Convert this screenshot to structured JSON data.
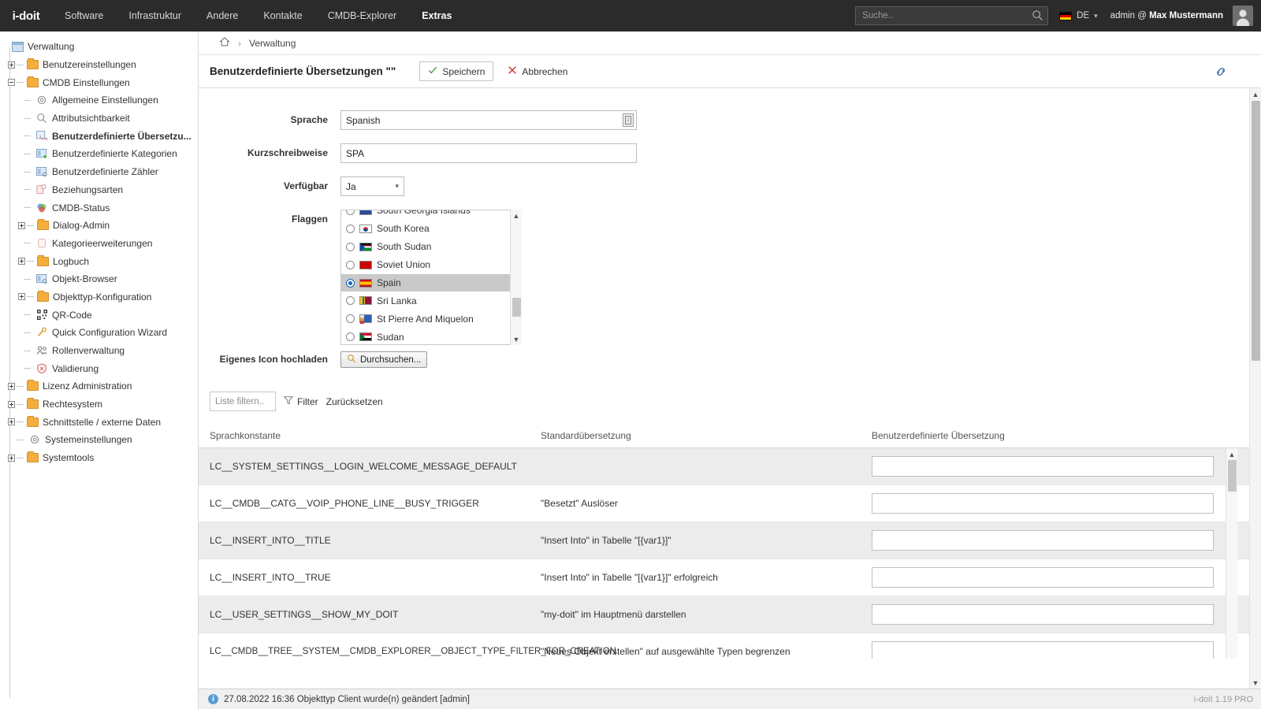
{
  "app": {
    "logo": "i-doit",
    "version_label": "i-doit 1.19 PRO"
  },
  "topnav": {
    "items": [
      {
        "label": "Software",
        "active": false
      },
      {
        "label": "Infrastruktur",
        "active": false
      },
      {
        "label": "Andere",
        "active": false
      },
      {
        "label": "Kontakte",
        "active": false
      },
      {
        "label": "CMDB-Explorer",
        "active": false
      },
      {
        "label": "Extras",
        "active": true
      }
    ],
    "search_placeholder": "Suche..",
    "search_value": "",
    "language": "DE",
    "user": "admin @ ",
    "user_name": "Max Mustermann"
  },
  "sidebar": {
    "root": "Verwaltung",
    "items": [
      {
        "label": "Verwaltung",
        "level": 0,
        "icon": "window-icon",
        "toggle": "none",
        "selected": false
      },
      {
        "label": "Benutzereinstellungen",
        "level": 1,
        "icon": "folder-icon",
        "toggle": "plus",
        "selected": false
      },
      {
        "label": "CMDB Einstellungen",
        "level": 1,
        "icon": "folder-icon",
        "toggle": "minus",
        "selected": false
      },
      {
        "label": "Allgemeine Einstellungen",
        "level": 2,
        "icon": "gear-icon",
        "toggle": "dash",
        "selected": false
      },
      {
        "label": "Attributsichtbarkeit",
        "level": 2,
        "icon": "search-icon",
        "toggle": "dash",
        "selected": false
      },
      {
        "label": "Benutzerdefinierte Übersetzu...",
        "level": 2,
        "icon": "translation-icon",
        "toggle": "dash",
        "selected": true
      },
      {
        "label": "Benutzerdefinierte Kategorien",
        "level": 2,
        "icon": "category-icon",
        "toggle": "dash",
        "selected": false
      },
      {
        "label": "Benutzerdefinierte Zähler",
        "level": 2,
        "icon": "counter-icon",
        "toggle": "dash",
        "selected": false
      },
      {
        "label": "Beziehungsarten",
        "level": 2,
        "icon": "relation-icon",
        "toggle": "dash",
        "selected": false
      },
      {
        "label": "CMDB-Status",
        "level": 2,
        "icon": "status-icon",
        "toggle": "dash",
        "selected": false
      },
      {
        "label": "Dialog-Admin",
        "level": 2,
        "icon": "folder-icon",
        "toggle": "plus",
        "selected": false
      },
      {
        "label": "Kategorieerweiterungen",
        "level": 2,
        "icon": "extension-icon",
        "toggle": "dash",
        "selected": false
      },
      {
        "label": "Logbuch",
        "level": 2,
        "icon": "folder-icon",
        "toggle": "plus",
        "selected": false
      },
      {
        "label": "Objekt-Browser",
        "level": 2,
        "icon": "browser-icon",
        "toggle": "dash",
        "selected": false
      },
      {
        "label": "Objekttyp-Konfiguration",
        "level": 2,
        "icon": "folder-icon",
        "toggle": "plus",
        "selected": false
      },
      {
        "label": "QR-Code",
        "level": 2,
        "icon": "qrcode-icon",
        "toggle": "dash",
        "selected": false
      },
      {
        "label": "Quick Configuration Wizard",
        "level": 2,
        "icon": "wand-icon",
        "toggle": "dash",
        "selected": false
      },
      {
        "label": "Rollenverwaltung",
        "level": 2,
        "icon": "users-icon",
        "toggle": "dash",
        "selected": false
      },
      {
        "label": "Validierung",
        "level": 2,
        "icon": "shield-icon",
        "toggle": "dash",
        "selected": false
      },
      {
        "label": "Lizenz Administration",
        "level": 1,
        "icon": "folder-icon",
        "toggle": "plus",
        "selected": false
      },
      {
        "label": "Rechtesystem",
        "level": 1,
        "icon": "folder-icon",
        "toggle": "plus",
        "selected": false
      },
      {
        "label": "Schnittstelle / externe Daten",
        "level": 1,
        "icon": "folder-icon",
        "toggle": "plus",
        "selected": false
      },
      {
        "label": "Systemeinstellungen",
        "level": 1,
        "icon": "gear-icon",
        "toggle": "dash",
        "selected": false
      },
      {
        "label": "Systemtools",
        "level": 1,
        "icon": "folder-icon",
        "toggle": "plus",
        "selected": false
      }
    ]
  },
  "breadcrumb": {
    "home": "home-icon",
    "separator": "›",
    "current": "Verwaltung"
  },
  "header": {
    "title": "Benutzerdefinierte Übersetzungen \"\"",
    "save_label": "Speichern",
    "cancel_label": "Abbrechen"
  },
  "form": {
    "sprache_label": "Sprache",
    "sprache_value": "Spanish",
    "kurz_label": "Kurzschreibweise",
    "kurz_value": "SPA",
    "verfuegbar_label": "Verfügbar",
    "verfuegbar_value": "Ja",
    "flaggen_label": "Flaggen",
    "flags": [
      {
        "name": "South Georgia Islands",
        "selected": false,
        "c1": "#3a5aa8",
        "c2": "#ffffff",
        "partial": true
      },
      {
        "name": "South Korea",
        "selected": false,
        "c1": "#ffffff",
        "c2": "#cd2e3a"
      },
      {
        "name": "South Sudan",
        "selected": false,
        "c1": "#078930",
        "c2": "#0f47af"
      },
      {
        "name": "Soviet Union",
        "selected": false,
        "c1": "#cd0000",
        "c2": "#ffd700"
      },
      {
        "name": "Spain",
        "selected": true,
        "c1": "#c60b1e",
        "c2": "#ffc400"
      },
      {
        "name": "Sri Lanka",
        "selected": false,
        "c1": "#ffbe29",
        "c2": "#8d153a"
      },
      {
        "name": "St Pierre And Miquelon",
        "selected": false,
        "c1": "#2c5fb3",
        "c2": "#e8e8e8"
      },
      {
        "name": "Sudan",
        "selected": false,
        "c1": "#d21034",
        "c2": "#ffffff"
      }
    ],
    "upload_label": "Eigenes Icon hochladen",
    "upload_button": "Durchsuchen..."
  },
  "filterbar": {
    "placeholder": "Liste filtern..",
    "value": "",
    "filter_label": "Filter",
    "reset_label": "Zurücksetzen"
  },
  "table": {
    "columns": [
      "Sprachkonstante",
      "Standardübersetzung",
      "Benutzerdefinierte Übersetzung"
    ],
    "rows": [
      {
        "constant": "LC__SYSTEM_SETTINGS__LOGIN_WELCOME_MESSAGE_DEFAULT",
        "default": "",
        "custom": ""
      },
      {
        "constant": "LC__CMDB__CATG__VOIP_PHONE_LINE__BUSY_TRIGGER",
        "default": "\"Besetzt\" Auslöser",
        "custom": ""
      },
      {
        "constant": "LC__INSERT_INTO__TITLE",
        "default": "\"Insert Into\" in Tabelle \"[{var1}]\"",
        "custom": ""
      },
      {
        "constant": "LC__INSERT_INTO__TRUE",
        "default": "\"Insert Into\" in Tabelle \"[{var1}]\" erfolgreich",
        "custom": ""
      },
      {
        "constant": "LC__USER_SETTINGS__SHOW_MY_DOIT",
        "default": "\"my-doit\" im Hauptmenü darstellen",
        "custom": ""
      },
      {
        "constant": "LC__CMDB__TREE__SYSTEM__CMDB_EXPLORER__OBJECT_TYPE_FILTER_FOR_CREATION",
        "default": "\"Neues Objekt erstellen\" auf ausgewählte Typen begrenzen",
        "custom": ""
      }
    ]
  },
  "footer": {
    "message": "27.08.2022 16:36 Objekttyp Client wurde(n) geändert [admin]",
    "version": "i-doit 1.19 PRO"
  },
  "colors": {
    "topbar_bg": "#2b2b2b",
    "accent_green": "#3c9a3c",
    "accent_red": "#cc3333",
    "link_blue": "#3a6ea5"
  }
}
